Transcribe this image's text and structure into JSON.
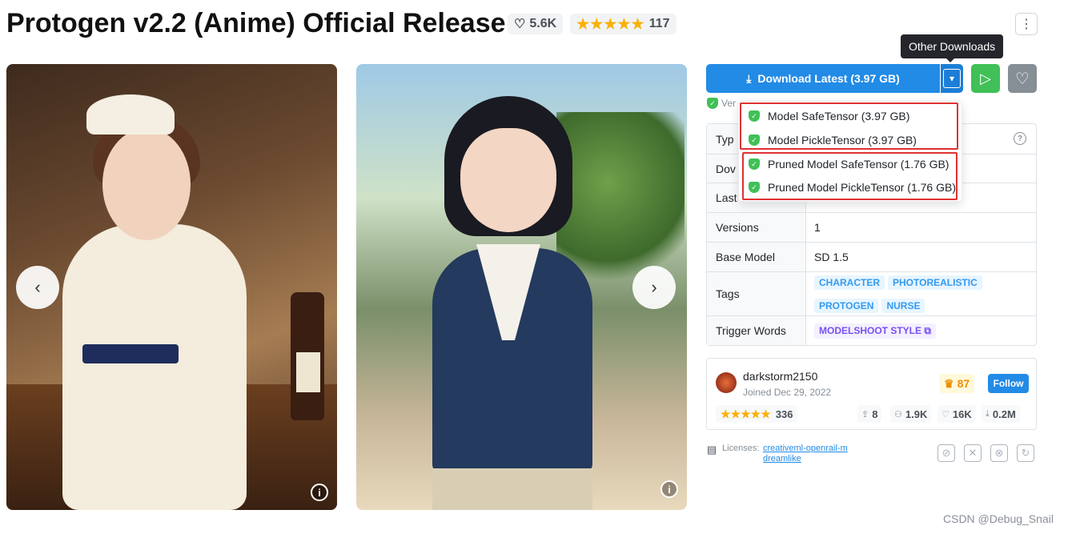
{
  "header": {
    "title": "Protogen v2.2 (Anime) Official Release",
    "likes": "5.6K",
    "rating_stars": "★★★★★",
    "rating_count": "117"
  },
  "gallery": {
    "prev_glyph": "‹",
    "next_glyph": "›",
    "info_glyph": "i"
  },
  "download": {
    "main_label": "Download Latest (3.97 GB)",
    "tooltip": "Other Downloads",
    "options": [
      "Model SafeTensor (3.97 GB)",
      "Model PickleTensor (3.97 GB)",
      "Pruned Model SafeTensor (1.76 GB)",
      "Pruned Model PickleTensor (1.76 GB)"
    ],
    "verified_text": "Ver"
  },
  "details": {
    "rows": [
      {
        "key": "Typ",
        "value": ""
      },
      {
        "key": "Dov",
        "value": ""
      },
      {
        "key": "Last",
        "value": ""
      },
      {
        "key": "Versions",
        "value": "1"
      },
      {
        "key": "Base Model",
        "value": "SD 1.5"
      },
      {
        "key": "Tags",
        "value": ""
      },
      {
        "key": "Trigger Words",
        "value": ""
      }
    ],
    "tags": [
      "CHARACTER",
      "PHOTOREALISTIC",
      "PROTOGEN",
      "NURSE"
    ],
    "trigger_word": "MODELSHOOT STYLE"
  },
  "creator": {
    "name": "darkstorm2150",
    "joined": "Joined Dec 29, 2022",
    "crown_count": "87",
    "follow_label": "Follow",
    "rating_stars": "★★★★★",
    "rating_count": "336",
    "uploads": "8",
    "followers": "1.9K",
    "favorites": "16K",
    "downloads": "0.2M"
  },
  "license": {
    "label": "Licenses:",
    "links": [
      "creativeml-openrail-m",
      "dreamlike"
    ]
  },
  "watermark": "CSDN @Debug_Snail",
  "colors": {
    "primary": "#228be6",
    "success": "#40c057",
    "gray": "#868e96",
    "star": "#fab005",
    "highlight": "#e03131"
  }
}
